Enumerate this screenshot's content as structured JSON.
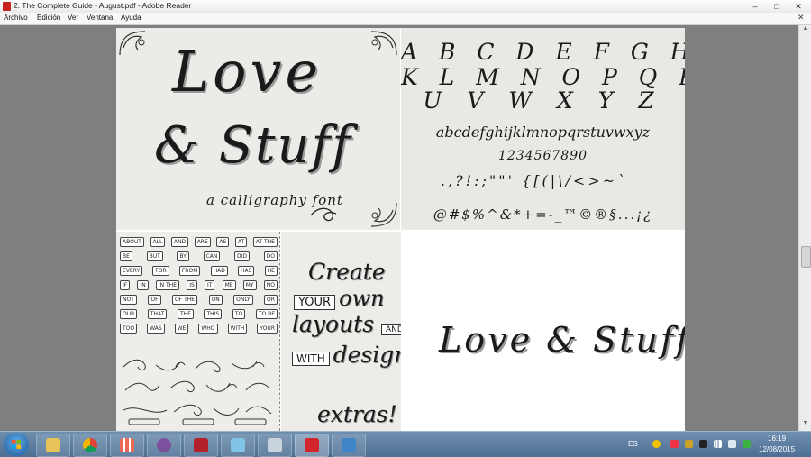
{
  "window": {
    "title": "2. The Complete Guide - August.pdf - Adobe Reader",
    "min_glyph": "–",
    "max_glyph": "□",
    "close_glyph": "✕"
  },
  "menubar": {
    "items": [
      "Archivo",
      "Edición",
      "Ver",
      "Ventana",
      "Ayuda"
    ],
    "close_glyph": "✕"
  },
  "document": {
    "cover": {
      "title_line1": "Love",
      "title_line2": "& Stuff",
      "subtitle": "a calligraphy font"
    },
    "alphabet": {
      "upper1": "A B C D E F G H I J",
      "upper2": "K L M N O P Q R S T",
      "upper3": "U V W X Y Z",
      "lower": "abcdefghijklmnopqrstuvwxyz",
      "digits": "1234567890",
      "punct1": ".,?!:;\"\"' {[(|\\/<>~`",
      "punct2": "@#$%^&*+=-_™©®§...¡¿"
    },
    "words": {
      "rows": [
        [
          "ABOUT",
          "ALL",
          "AND",
          "ARE",
          "AS",
          "AT",
          "AT THE"
        ],
        [
          "BE",
          "BUT",
          "BY",
          "CAN",
          "DID",
          "DO"
        ],
        [
          "EVERY",
          "FOR",
          "FROM",
          "HAD",
          "HAS",
          "HE"
        ],
        [
          "IF",
          "IN",
          "IN THE",
          "IS",
          "IT",
          "ME",
          "MY",
          "NO"
        ],
        [
          "NOT",
          "OF",
          "OF THE",
          "ON",
          "ONLY",
          "OR"
        ],
        [
          "OUR",
          "THAT",
          "THE",
          "THIS",
          "TO",
          "TO BE"
        ],
        [
          "TOO",
          "WAS",
          "WE",
          "WHO",
          "WITH",
          "YOUR"
        ]
      ]
    },
    "create": {
      "line1": "Create",
      "line2a": "YOUR",
      "line2b": "own",
      "line3a": "layouts",
      "line3b": "AND",
      "line4a": "WITH",
      "line4b": "design",
      "line5": "extras!"
    },
    "sample": {
      "text": "Love & Stuff"
    }
  },
  "scrollbar": {
    "up_glyph": "▲",
    "down_glyph": "▼"
  },
  "taskbar": {
    "pinned": [
      "file-explorer",
      "chrome",
      "apps",
      "viber",
      "acrobat-pro",
      "notepad",
      "calculator",
      "adobe-reader",
      "photo-viewer"
    ],
    "tray_lang": "ES",
    "clock_time": "16:19",
    "clock_date": "12/08/2015"
  },
  "colors": {
    "chrome": "#f7f7f7",
    "viewport_bg": "#7f7f7f",
    "taskbar": "#4d6f93",
    "ink": "#1a1a1a",
    "reader_red": "#c8201e"
  }
}
